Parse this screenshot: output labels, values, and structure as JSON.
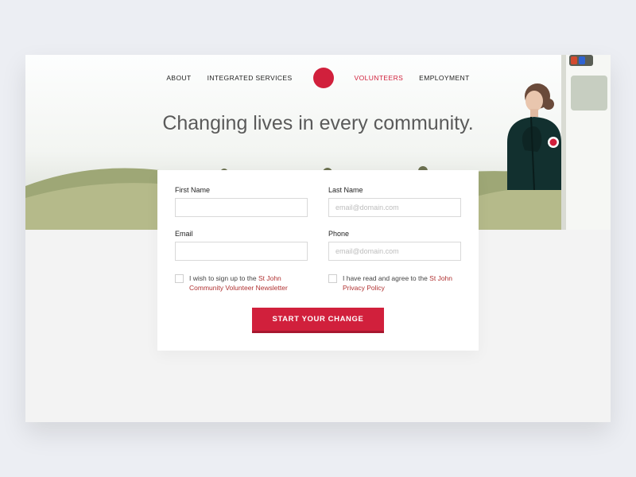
{
  "nav": {
    "items": [
      {
        "label": "ABOUT",
        "active": false
      },
      {
        "label": "INTEGRATED SERVICES",
        "active": false
      },
      {
        "label": "VOLUNTEERS",
        "active": true
      },
      {
        "label": "EMPLOYMENT",
        "active": false
      }
    ]
  },
  "headline": "Changing lives in every community.",
  "form": {
    "first_name": {
      "label": "First Name",
      "value": "",
      "placeholder": ""
    },
    "last_name": {
      "label": "Last Name",
      "value": "",
      "placeholder": "email@domain.com"
    },
    "email": {
      "label": "Email",
      "value": "",
      "placeholder": ""
    },
    "phone": {
      "label": "Phone",
      "value": "",
      "placeholder": "email@domain.com"
    },
    "newsletter_check": {
      "lead": "I wish to sign up to the ",
      "link": "St John Community Volunteer Newsletter"
    },
    "privacy_check": {
      "lead": "I have read and agree to the ",
      "link": "St John Privacy Policy"
    },
    "submit_label": "START YOUR CHANGE"
  },
  "colors": {
    "accent": "#d1203c"
  }
}
